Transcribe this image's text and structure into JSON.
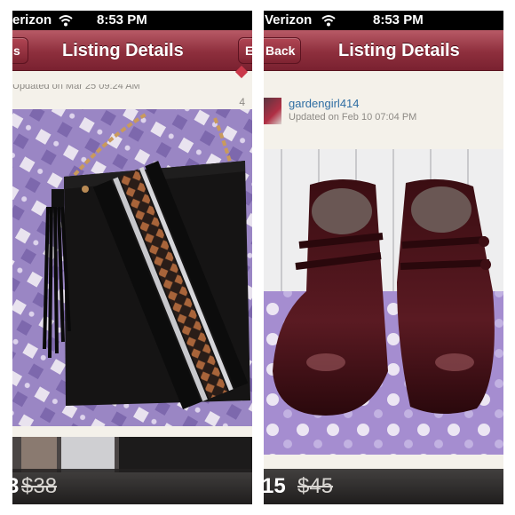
{
  "left_screen": {
    "status": {
      "carrier": "erizon",
      "time": "8:53 PM"
    },
    "nav": {
      "title": "Listing Details",
      "left_button": "s",
      "right_button": "E"
    },
    "listing": {
      "updated": "Updated on Mar 25 09:24 AM",
      "like_count": "4",
      "photo": "black-leather-studded-crossbody-bag"
    },
    "price": {
      "current": "3",
      "original": "$38"
    }
  },
  "right_screen": {
    "status": {
      "carrier": "Verizon",
      "time": "8:53 PM"
    },
    "nav": {
      "title": "Listing Details",
      "back_button": "Back"
    },
    "listing": {
      "seller": "gardengirl414",
      "updated": "Updated on Feb 10 07:04 PM",
      "photo": "brown-patent-mary-jane-shoes"
    },
    "price": {
      "current": "15",
      "original": "$45"
    }
  },
  "colors": {
    "nav_bar": "#8e2f3d",
    "status_bar": "#000000",
    "seller_link": "#2f6ea3",
    "price_bar": "#1e1c1c"
  },
  "icons": [
    "wifi-icon",
    "heart-icon",
    "avatar"
  ]
}
